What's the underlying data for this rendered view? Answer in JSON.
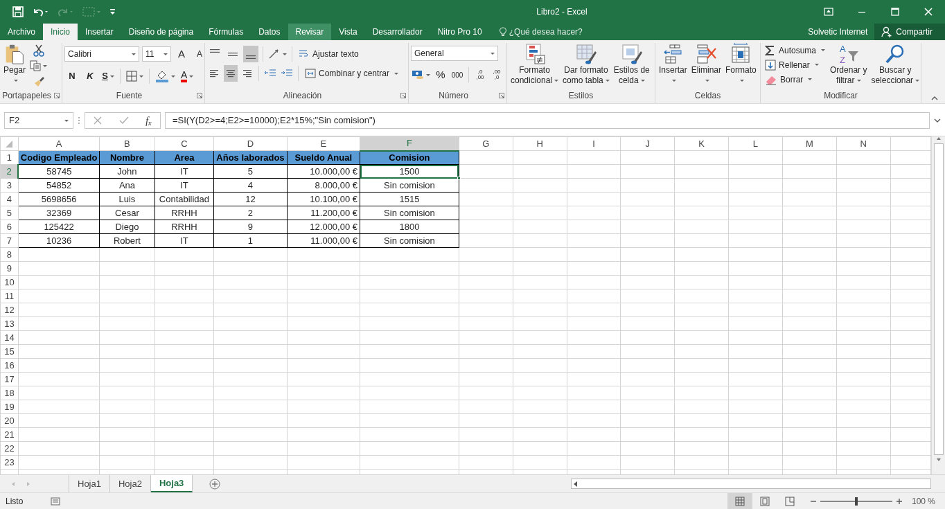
{
  "window": {
    "title": "Libro2 - Excel"
  },
  "quick_access": [
    {
      "disabled": false
    },
    {
      "disabled": false
    },
    {
      "disabled": true
    },
    {
      "disabled": true
    },
    {
      "disabled": false
    }
  ],
  "menu_tabs": [
    {
      "label": "Archivo",
      "selected": false,
      "hover": false
    },
    {
      "label": "Inicio",
      "selected": true,
      "hover": false
    },
    {
      "label": "Insertar",
      "selected": false,
      "hover": false
    },
    {
      "label": "Diseño de página",
      "selected": false,
      "hover": false
    },
    {
      "label": "Fórmulas",
      "selected": false,
      "hover": false
    },
    {
      "label": "Datos",
      "selected": false,
      "hover": false
    },
    {
      "label": "Revisar",
      "selected": false,
      "hover": true
    },
    {
      "label": "Vista",
      "selected": false,
      "hover": false
    },
    {
      "label": "Desarrollador",
      "selected": false,
      "hover": false
    },
    {
      "label": "Nitro Pro 10",
      "selected": false,
      "hover": false
    }
  ],
  "tell_me": "¿Qué desea hacer?",
  "user": "Solvetic Internet",
  "share_button": "Compartir",
  "ribbon": {
    "groups": [
      {
        "label": "Portapapeles",
        "launcher": true,
        "paste": "Pegar"
      },
      {
        "label": "Fuente",
        "launcher": true,
        "font": "Calibri",
        "size": "11",
        "grow": "A",
        "shrink": "A",
        "bold": "N",
        "italic": "K",
        "underline": "S",
        "font_color": "A"
      },
      {
        "label": "Alineación",
        "launcher": true,
        "vertical_align": [
          {
            "selected": false
          },
          {
            "selected": false
          },
          {
            "selected": true
          }
        ],
        "horizontal_align": [
          {
            "selected": false
          },
          {
            "selected": true
          },
          {
            "selected": false
          }
        ],
        "wrap": "Ajustar texto",
        "merge": "Combinar y centrar"
      },
      {
        "label": "Número",
        "launcher": true,
        "format": "General",
        "percent": "%",
        "thousands": "000",
        "increase_decimals": [
          ",0",
          ",00"
        ],
        "decrease_decimals": [
          ",00",
          ",0"
        ]
      },
      {
        "label": "Estilos",
        "buttons": [
          {
            "lines": [
              "Formato",
              "condicional"
            ]
          },
          {
            "lines": [
              "Dar formato",
              "como tabla"
            ]
          },
          {
            "lines": [
              "Estilos de",
              "celda"
            ]
          }
        ]
      },
      {
        "label": "Celdas",
        "buttons": [
          {
            "lines": [
              "Insertar"
            ]
          },
          {
            "lines": [
              "Eliminar"
            ]
          },
          {
            "lines": [
              "Formato"
            ]
          }
        ]
      },
      {
        "label": "Modificar",
        "small_buttons": [
          "Autosuma",
          "Rellenar",
          "Borrar"
        ],
        "sort_letters": [
          "A",
          "Z"
        ],
        "buttons": [
          {
            "lines": [
              "Ordenar y",
              "filtrar"
            ]
          },
          {
            "lines": [
              "Buscar y",
              "seleccionar"
            ]
          }
        ]
      }
    ]
  },
  "formula_bar": {
    "name_box": "F2",
    "fx": "f$_{x}$",
    "formula": "=SI(Y(D2>=4;E2>=10000);E2*15%;\"Sin comision\")"
  },
  "sheet": {
    "columns": [
      {
        "label": "A",
        "selected": false
      },
      {
        "label": "B",
        "selected": false
      },
      {
        "label": "C",
        "selected": false
      },
      {
        "label": "D",
        "selected": false
      },
      {
        "label": "E",
        "selected": false
      },
      {
        "label": "F",
        "selected": true
      },
      {
        "label": "G",
        "selected": false
      },
      {
        "label": "H",
        "selected": false
      },
      {
        "label": "I",
        "selected": false
      },
      {
        "label": "J",
        "selected": false
      },
      {
        "label": "K",
        "selected": false
      },
      {
        "label": "L",
        "selected": false
      },
      {
        "label": "M",
        "selected": false
      },
      {
        "label": "N",
        "selected": false
      }
    ],
    "rows": [
      {
        "number": "1",
        "selected": false,
        "kind": "header",
        "cells": [
          "Codigo Empleado",
          "Nombre",
          "Area",
          "Años laborados",
          "Sueldo Anual",
          "Comision"
        ]
      },
      {
        "number": "2",
        "selected": true,
        "kind": "data",
        "cells": [
          "58745",
          "John",
          "IT",
          "5",
          "10.000,00 €",
          "1500"
        ]
      },
      {
        "number": "3",
        "selected": false,
        "kind": "data",
        "cells": [
          "54852",
          "Ana",
          "IT",
          "4",
          "8.000,00 €",
          "Sin comision"
        ]
      },
      {
        "number": "4",
        "selected": false,
        "kind": "data",
        "cells": [
          "5698656",
          "Luis",
          "Contabilidad",
          "12",
          "10.100,00 €",
          "1515"
        ]
      },
      {
        "number": "5",
        "selected": false,
        "kind": "data",
        "cells": [
          "32369",
          "Cesar",
          "RRHH",
          "2",
          "11.200,00 €",
          "Sin comision"
        ]
      },
      {
        "number": "6",
        "selected": false,
        "kind": "data",
        "cells": [
          "125422",
          "Diego",
          "RRHH",
          "9",
          "12.000,00 €",
          "1800"
        ]
      },
      {
        "number": "7",
        "selected": false,
        "kind": "data",
        "cells": [
          "10236",
          "Robert",
          "IT",
          "1",
          "11.000,00 €",
          "Sin comision"
        ]
      },
      {
        "number": "8",
        "selected": false
      },
      {
        "number": "9",
        "selected": false
      },
      {
        "number": "10",
        "selected": false
      },
      {
        "number": "11",
        "selected": false
      },
      {
        "number": "12",
        "selected": false
      },
      {
        "number": "13",
        "selected": false
      },
      {
        "number": "14",
        "selected": false
      },
      {
        "number": "15",
        "selected": false
      },
      {
        "number": "16",
        "selected": false
      },
      {
        "number": "17",
        "selected": false
      },
      {
        "number": "18",
        "selected": false
      },
      {
        "number": "19",
        "selected": false
      },
      {
        "number": "20",
        "selected": false
      },
      {
        "number": "21",
        "selected": false
      },
      {
        "number": "22",
        "selected": false
      },
      {
        "number": "23",
        "selected": false
      }
    ]
  },
  "sheet_tabs": [
    {
      "label": "Hoja1",
      "selected": false
    },
    {
      "label": "Hoja2",
      "selected": false
    },
    {
      "label": "Hoja3",
      "selected": true
    }
  ],
  "status_bar": {
    "text": "Listo",
    "views": [
      {
        "selected": true
      },
      {
        "selected": false
      },
      {
        "selected": false
      }
    ],
    "zoom": {
      "label": "100 %",
      "level": 0.5
    }
  }
}
